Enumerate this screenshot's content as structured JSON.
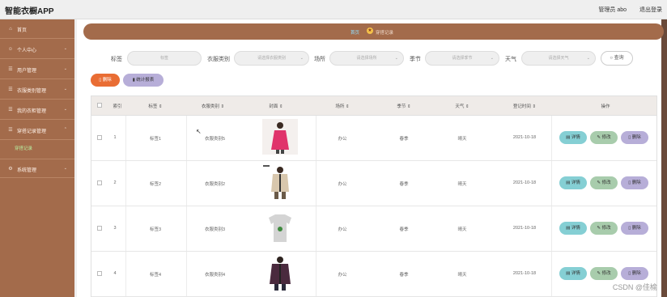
{
  "app": {
    "title": "智能衣橱APP",
    "user": "管理员 abo",
    "logout": "退出登录"
  },
  "sidebar": {
    "items": [
      {
        "label": "首页",
        "icon": "home-icon"
      },
      {
        "label": "个人中心",
        "icon": "user-icon"
      },
      {
        "label": "用户管理",
        "icon": "users-icon"
      },
      {
        "label": "衣服类别管理",
        "icon": "list-icon"
      },
      {
        "label": "我的衣柜管理",
        "icon": "wardrobe-icon"
      },
      {
        "label": "穿搭记录管理",
        "icon": "record-icon"
      },
      {
        "label": "系统管理",
        "icon": "settings-icon"
      }
    ],
    "sub_item": "穿搭记录"
  },
  "breadcrumb": {
    "home": "首页",
    "current": "穿搭记录"
  },
  "search": {
    "title_label": "标签",
    "title_placeholder": "标签",
    "type_label": "衣服类别",
    "type_placeholder": "请选择衣服类别",
    "place_label": "场所",
    "place_placeholder": "请选择场所",
    "season_label": "季节",
    "season_placeholder": "请选择季节",
    "weather_label": "天气",
    "weather_placeholder": "请选择天气",
    "button": "查询"
  },
  "toolbar": {
    "delete": "删除",
    "stats": "统计报表"
  },
  "table": {
    "headers": [
      "索引",
      "标签",
      "衣服类别",
      "封面",
      "场所",
      "季节",
      "天气",
      "登记时间",
      "操作"
    ],
    "rows": [
      {
        "index": "1",
        "title": "标签1",
        "type": "衣服类别5",
        "place": "办公",
        "season": "春季",
        "weather": "晴天",
        "date": "2021-10-18"
      },
      {
        "index": "2",
        "title": "标签2",
        "type": "衣服类别2",
        "place": "办公",
        "season": "春季",
        "weather": "晴天",
        "date": "2021-10-18"
      },
      {
        "index": "3",
        "title": "标签3",
        "type": "衣服类别3",
        "place": "办公",
        "season": "春季",
        "weather": "晴天",
        "date": "2021-10-18"
      },
      {
        "index": "4",
        "title": "标签4",
        "type": "衣服类别4",
        "place": "办公",
        "season": "春季",
        "weather": "晴天",
        "date": "2021-10-18"
      }
    ],
    "actions": {
      "detail": "详情",
      "edit": "修改",
      "delete": "删除"
    }
  },
  "watermark": "CSDN @佳榆",
  "colors": {
    "sidebar": "#a36b4b",
    "breadcrumb": "#a36b4b",
    "delete_btn": "#e96d34",
    "stats_btn": "#b7aed8",
    "detail_btn": "#85cfd4",
    "edit_btn": "#a8ccac"
  }
}
